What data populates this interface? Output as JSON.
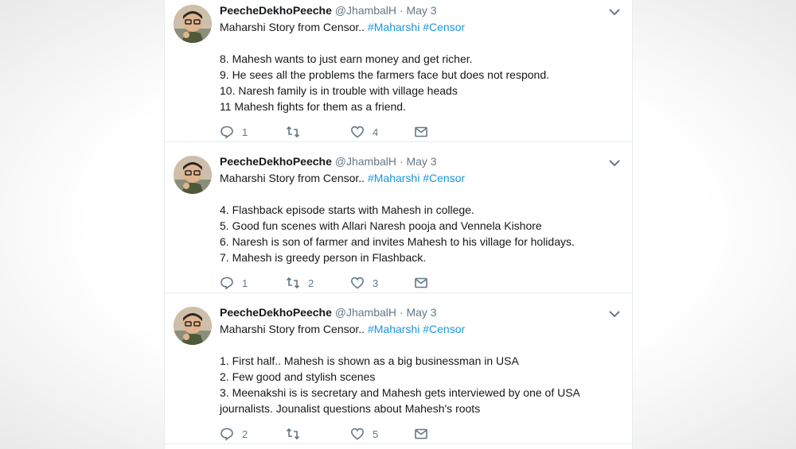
{
  "tweets": [
    {
      "name": "PeecheDekhoPeeche",
      "handle": "@JhambalH",
      "dot": "·",
      "date": "May 3",
      "intro_text": "Maharshi Story from Censor..",
      "hashtags": [
        "#Maharshi",
        "#Censor"
      ],
      "lines": [
        "8. Mahesh wants to just earn money and get richer.",
        "9. He sees all the problems the farmers face but does not respond.",
        "10. Naresh family is in trouble with village heads",
        "11 Mahesh fights for them as a friend."
      ],
      "replies": "1",
      "retweets": "",
      "likes": "4"
    },
    {
      "name": "PeecheDekhoPeeche",
      "handle": "@JhambalH",
      "dot": "·",
      "date": "May 3",
      "intro_text": "Maharshi Story from Censor..",
      "hashtags": [
        "#Maharshi",
        "#Censor"
      ],
      "lines": [
        "4. Flashback episode starts with Mahesh in college.",
        "5. Good fun scenes with Allari Naresh pooja and Vennela Kishore",
        "6. Naresh is son of farmer and invites Mahesh to his village for holidays.",
        "7. Mahesh is greedy person in Flashback."
      ],
      "replies": "1",
      "retweets": "2",
      "likes": "3"
    },
    {
      "name": "PeecheDekhoPeeche",
      "handle": "@JhambalH",
      "dot": "·",
      "date": "May 3",
      "intro_text": "Maharshi Story from Censor..",
      "hashtags": [
        "#Maharshi",
        "#Censor"
      ],
      "lines": [
        "1. First half.. Mahesh is shown as a big businessman in USA",
        "2. Few good and stylish scenes",
        "3. Meenakshi is is secretary and Mahesh gets interviewed by one of USA",
        "journalists. Jounalist questions about Mahesh's roots"
      ],
      "replies": "2",
      "retweets": "",
      "likes": "5"
    }
  ],
  "icons": {
    "reply": "reply-icon",
    "retweet": "retweet-icon",
    "like": "heart-icon",
    "dm": "envelope-icon",
    "caret": "chevron-down-icon"
  },
  "colors": {
    "hashtag": "#1b95e0",
    "secondary_text": "#657786",
    "primary_text": "#14171a"
  }
}
